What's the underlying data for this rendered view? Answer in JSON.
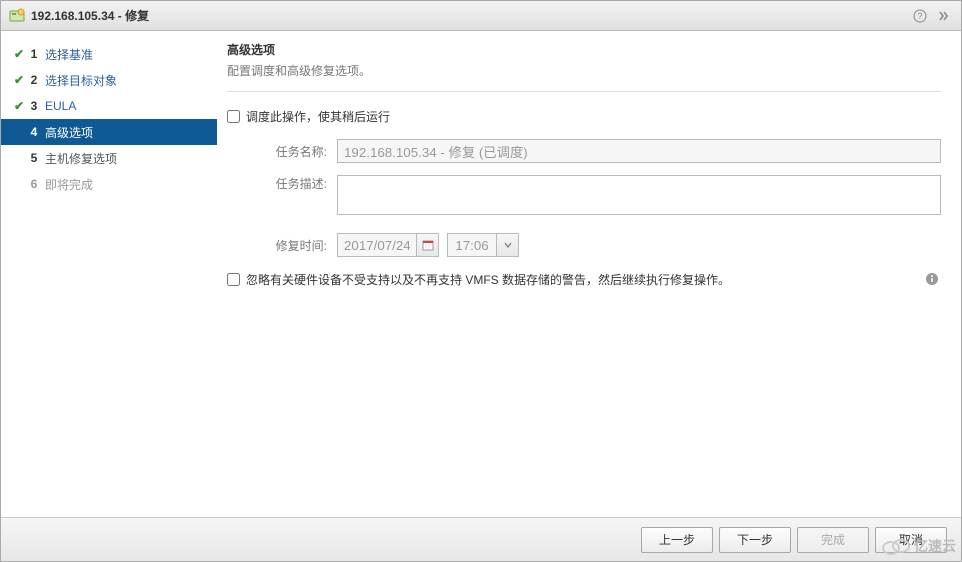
{
  "title": "192.168.105.34 - 修复",
  "sidebar": {
    "steps": [
      {
        "num": "1",
        "label": "选择基准",
        "state": "done"
      },
      {
        "num": "2",
        "label": "选择目标对象",
        "state": "done"
      },
      {
        "num": "3",
        "label": "EULA",
        "state": "done"
      },
      {
        "num": "4",
        "label": "高级选项",
        "state": "active"
      },
      {
        "num": "5",
        "label": "主机修复选项",
        "state": "pending"
      },
      {
        "num": "6",
        "label": "即将完成",
        "state": "disabled"
      }
    ]
  },
  "main": {
    "section_title": "高级选项",
    "section_desc": "配置调度和高级修复选项。",
    "schedule_checkbox_label": "调度此操作，使其稍后运行",
    "task_name_label": "任务名称:",
    "task_name_value": "192.168.105.34 - 修复 (已调度)",
    "task_desc_label": "任务描述:",
    "task_desc_value": "",
    "repair_time_label": "修复时间:",
    "date_value": "2017/07/24",
    "time_value": "17:06",
    "ignore_checkbox_label": "忽略有关硬件设备不受支持以及不再支持 VMFS 数据存储的警告，然后继续执行修复操作。"
  },
  "footer": {
    "back": "上一步",
    "next": "下一步",
    "finish": "完成",
    "cancel": "取消"
  },
  "watermark": "亿速云"
}
